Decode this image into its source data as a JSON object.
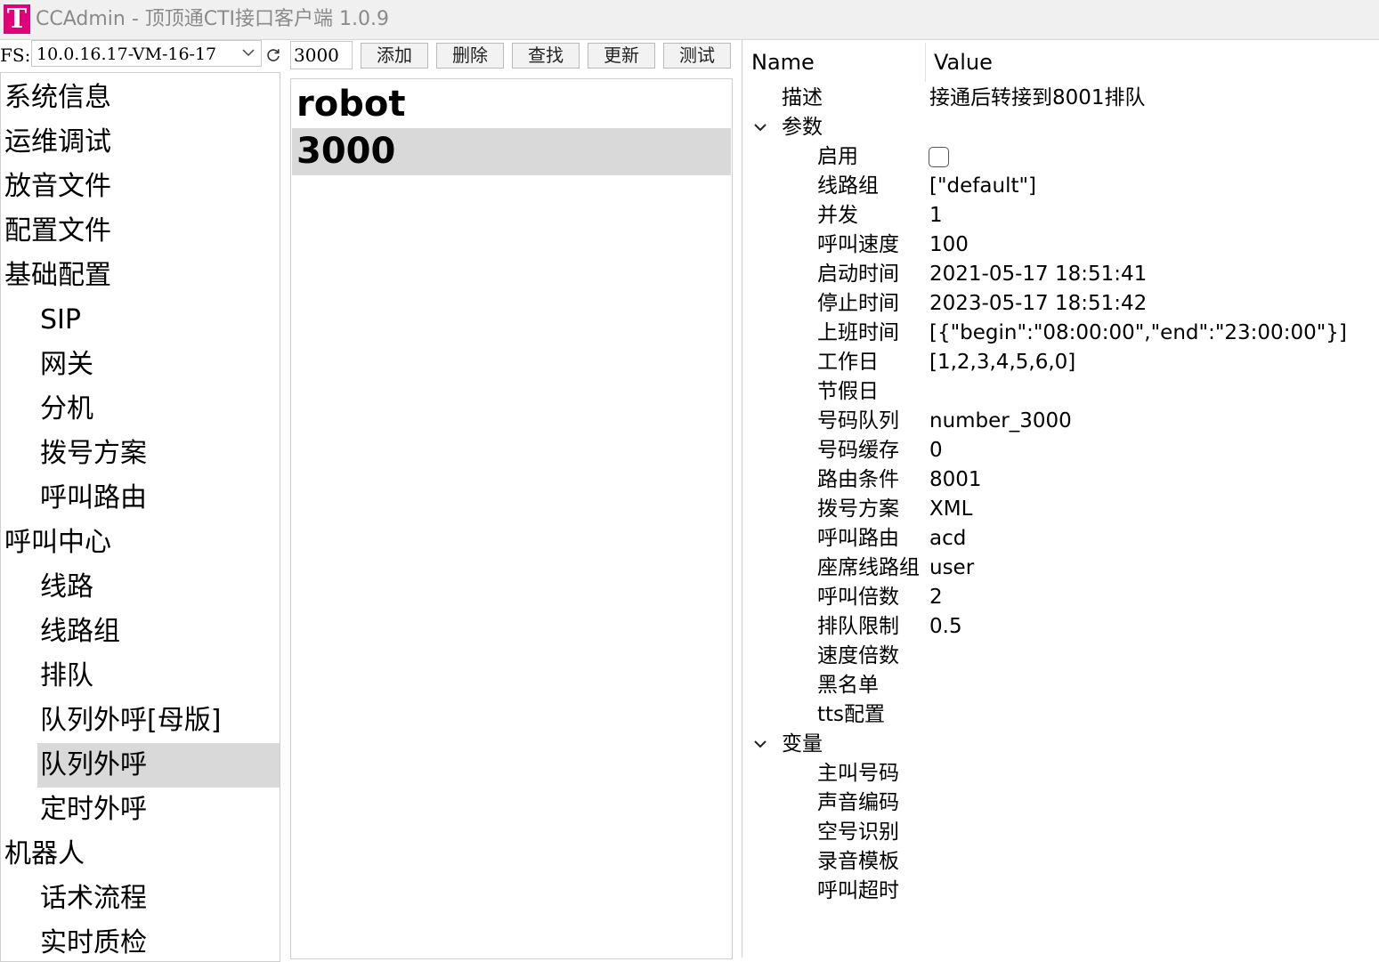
{
  "window": {
    "title": "CCAdmin - 顶顶通CTI接口客户端 1.0.9",
    "logo_letter": "T"
  },
  "toolbar": {
    "fs_label": "FS:",
    "fs_value": "10.0.16.17-VM-16-17",
    "number_value": "3000",
    "add_label": "添加",
    "delete_label": "删除",
    "find_label": "查找",
    "update_label": "更新",
    "test_label": "测试"
  },
  "nav": {
    "items": [
      {
        "label": "系统信息"
      },
      {
        "label": "运维调试"
      },
      {
        "label": "放音文件"
      },
      {
        "label": "配置文件"
      },
      {
        "label": "基础配置"
      },
      {
        "label": "SIP"
      },
      {
        "label": "网关"
      },
      {
        "label": "分机"
      },
      {
        "label": "拨号方案"
      },
      {
        "label": "呼叫路由"
      },
      {
        "label": "呼叫中心"
      },
      {
        "label": "线路"
      },
      {
        "label": "线路组"
      },
      {
        "label": "排队"
      },
      {
        "label": "队列外呼[母版]"
      },
      {
        "label": "队列外呼"
      },
      {
        "label": "定时外呼"
      },
      {
        "label": "机器人"
      },
      {
        "label": "话术流程"
      },
      {
        "label": "实时质检"
      }
    ]
  },
  "list": {
    "items": [
      {
        "label": "robot"
      },
      {
        "label": "3000"
      }
    ]
  },
  "props": {
    "header": {
      "name": "Name",
      "value": "Value"
    },
    "rows": [
      {
        "name": "描述",
        "value": "接通后转接到8001排队"
      },
      {
        "name": "参数",
        "value": ""
      },
      {
        "name": "启用",
        "value": ""
      },
      {
        "name": "线路组",
        "value": "[\"default\"]"
      },
      {
        "name": "并发",
        "value": "1"
      },
      {
        "name": "呼叫速度",
        "value": "100"
      },
      {
        "name": "启动时间",
        "value": "2021-05-17 18:51:41"
      },
      {
        "name": "停止时间",
        "value": "2023-05-17 18:51:42"
      },
      {
        "name": "上班时间",
        "value": "[{\"begin\":\"08:00:00\",\"end\":\"23:00:00\"}]"
      },
      {
        "name": "工作日",
        "value": "[1,2,3,4,5,6,0]"
      },
      {
        "name": "节假日",
        "value": ""
      },
      {
        "name": "号码队列",
        "value": "number_3000"
      },
      {
        "name": "号码缓存",
        "value": "0"
      },
      {
        "name": "路由条件",
        "value": "8001"
      },
      {
        "name": "拨号方案",
        "value": "XML"
      },
      {
        "name": "呼叫路由",
        "value": "acd"
      },
      {
        "name": "座席线路组",
        "value": "user"
      },
      {
        "name": "呼叫倍数",
        "value": "2"
      },
      {
        "name": "排队限制",
        "value": "0.5"
      },
      {
        "name": "速度倍数",
        "value": ""
      },
      {
        "name": "黑名单",
        "value": ""
      },
      {
        "name": "tts配置",
        "value": ""
      },
      {
        "name": "变量",
        "value": ""
      },
      {
        "name": "主叫号码",
        "value": ""
      },
      {
        "name": "声音编码",
        "value": ""
      },
      {
        "name": "空号识别",
        "value": ""
      },
      {
        "name": "录音模板",
        "value": ""
      },
      {
        "name": "呼叫超时",
        "value": ""
      }
    ]
  },
  "state": {
    "enabled_checked": false
  },
  "colors": {
    "logo": "#e0007a",
    "selection": "#d9d9d9"
  }
}
